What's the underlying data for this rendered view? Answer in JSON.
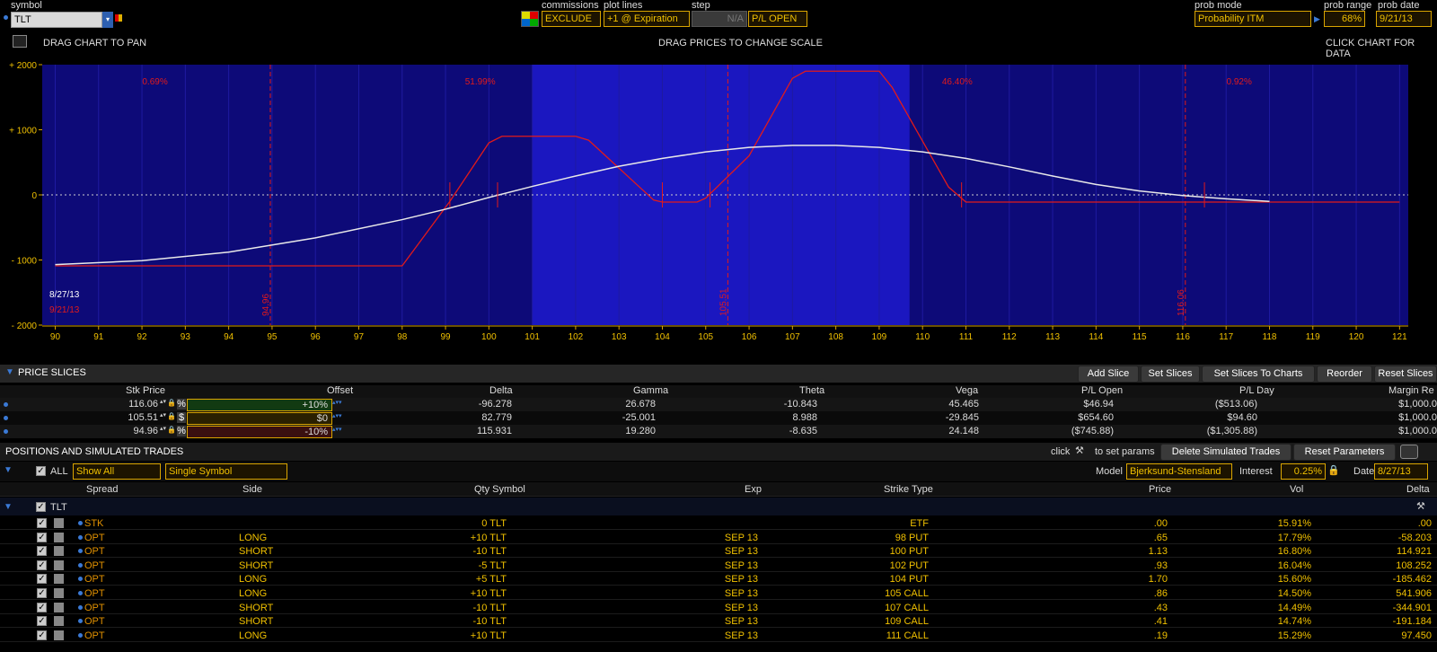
{
  "toolbar": {
    "symbol_label": "symbol",
    "symbol_value": "TLT",
    "commissions_label": "commissions",
    "commissions_value": "EXCLUDE",
    "plot_lines_label": "plot lines",
    "plot_lines_value": "+1 @ Expiration",
    "step_label": "step",
    "step_value": "N/A",
    "pl_mode_value": "P/L OPEN",
    "prob_mode_label": "prob mode",
    "prob_mode_value": "Probability ITM",
    "prob_range_label": "prob range",
    "prob_range_value": "68%",
    "prob_date_label": "prob date",
    "prob_date_value": "9/21/13"
  },
  "hints": {
    "pan": "DRAG CHART TO PAN",
    "scale": "DRAG PRICES TO CHANGE SCALE",
    "details": "CLICK CHART FOR DATA"
  },
  "chart_data": {
    "type": "line",
    "ylim": [
      -2000,
      2000
    ],
    "xlim": [
      89.7,
      121.2
    ],
    "y_ticks": [
      "+ 2000",
      "+ 1000",
      "0",
      "- 1000",
      "- 2000"
    ],
    "y_tick_values": [
      2000,
      1000,
      0,
      -1000,
      -2000
    ],
    "x_ticks": [
      90,
      91,
      92,
      93,
      94,
      95,
      96,
      97,
      98,
      99,
      100,
      101,
      102,
      103,
      104,
      105,
      106,
      107,
      108,
      109,
      110,
      111,
      112,
      113,
      114,
      115,
      116,
      117,
      118,
      119,
      120,
      121
    ],
    "prob_labels": [
      "0.69%",
      "51.99%",
      "46.40%",
      "0.92%"
    ],
    "prob_label_x": [
      92.3,
      99.8,
      110.8,
      117.3
    ],
    "slice_lines": [
      {
        "label": "94.96",
        "x": 94.96
      },
      {
        "label": "105.51",
        "x": 105.51
      },
      {
        "label": "116.06",
        "x": 116.06
      }
    ],
    "highlight_band": [
      101,
      109.7
    ],
    "dates": [
      "8/27/13",
      "9/21/13"
    ],
    "series": [
      {
        "name": "9/21/13",
        "color": "#e21a1a",
        "x": [
          90,
          98,
          99.1,
          100,
          100.3,
          102,
          102.3,
          103.8,
          104,
          104.8,
          105,
          106,
          107,
          107.3,
          109,
          109.3,
          110.6,
          111,
          121
        ],
        "values": [
          -1090,
          -1090,
          -100,
          800,
          900,
          900,
          840,
          -80,
          -110,
          -110,
          -50,
          600,
          1790,
          1900,
          1900,
          1650,
          120,
          -110,
          -110
        ]
      },
      {
        "name": "8/27/13",
        "color": "#e8e8e8",
        "x": [
          90,
          92,
          94,
          96,
          98,
          99,
          100,
          101,
          102,
          103,
          104,
          105,
          106,
          107,
          108,
          109,
          110,
          111,
          112,
          113,
          114,
          115,
          116,
          117,
          118
        ],
        "values": [
          -1070,
          -1010,
          -880,
          -660,
          -380,
          -220,
          -40,
          130,
          290,
          440,
          560,
          660,
          730,
          760,
          760,
          730,
          660,
          560,
          430,
          290,
          160,
          60,
          -10,
          -60,
          -100
        ]
      }
    ]
  },
  "price_slices": {
    "title": "PRICE SLICES",
    "buttons": [
      "Add Slice",
      "Set Slices",
      "Set Slices To Charts",
      "Reorder",
      "Reset Slices"
    ],
    "headers": [
      "Stk Price",
      "Offset",
      "Delta",
      "Gamma",
      "Theta",
      "Vega",
      "P/L Open",
      "P/L Day",
      "Margin Re"
    ],
    "rows": [
      {
        "stk": "116.06",
        "unit": "%",
        "offset": "+10%",
        "offset_color": "#123a12",
        "delta": "-96.278",
        "gamma": "26.678",
        "theta": "-10.843",
        "vega": "45.465",
        "pl_open": "$46.94",
        "pl_day": "($513.06)",
        "margin": "$1,000.0"
      },
      {
        "stk": "105.51",
        "unit": "$",
        "offset": "$0",
        "offset_color": "#2a2000",
        "delta": "82.779",
        "gamma": "-25.001",
        "theta": "8.988",
        "vega": "-29.845",
        "pl_open": "$654.60",
        "pl_day": "$94.60",
        "margin": "$1,000.0"
      },
      {
        "stk": "94.96",
        "unit": "%",
        "offset": "-10%",
        "offset_color": "#3a1010",
        "delta": "115.931",
        "gamma": "19.280",
        "theta": "-8.635",
        "vega": "24.148",
        "pl_open": "($745.88)",
        "pl_day": "($1,305.88)",
        "margin": "$1,000.0"
      }
    ]
  },
  "positions": {
    "title": "POSITIONS AND SIMULATED TRADES",
    "click_hint": "click",
    "click_hint2": "to set params",
    "delete_btn": "Delete Simulated Trades",
    "reset_btn": "Reset Parameters",
    "all_label": "ALL",
    "filter_value": "Show All",
    "symbol_mode": "Single Symbol",
    "model_label": "Model",
    "model_value": "Bjerksund-Stensland",
    "interest_label": "Interest",
    "interest_value": "0.25%",
    "date_label": "Date",
    "date_value": "8/27/13",
    "headers": [
      "Spread",
      "Side",
      "Qty Symbol",
      "Exp",
      "Strike Type",
      "Price",
      "Vol",
      "Delta"
    ],
    "group": "TLT",
    "rows": [
      {
        "spread": "STK",
        "side": "",
        "qty": "0 TLT",
        "exp": "",
        "strike": "ETF",
        "price": ".00",
        "vol": "15.91%",
        "delta": ".00"
      },
      {
        "spread": "OPT",
        "side": "LONG",
        "qty": "+10 TLT",
        "exp": "SEP 13",
        "strike": "98 PUT",
        "price": ".65",
        "vol": "17.79%",
        "delta": "-58.203"
      },
      {
        "spread": "OPT",
        "side": "SHORT",
        "qty": "-10 TLT",
        "exp": "SEP 13",
        "strike": "100 PUT",
        "price": "1.13",
        "vol": "16.80%",
        "delta": "114.921"
      },
      {
        "spread": "OPT",
        "side": "SHORT",
        "qty": "-5 TLT",
        "exp": "SEP 13",
        "strike": "102 PUT",
        "price": ".93",
        "vol": "16.04%",
        "delta": "108.252"
      },
      {
        "spread": "OPT",
        "side": "LONG",
        "qty": "+5 TLT",
        "exp": "SEP 13",
        "strike": "104 PUT",
        "price": "1.70",
        "vol": "15.60%",
        "delta": "-185.462"
      },
      {
        "spread": "OPT",
        "side": "LONG",
        "qty": "+10 TLT",
        "exp": "SEP 13",
        "strike": "105 CALL",
        "price": ".86",
        "vol": "14.50%",
        "delta": "541.906"
      },
      {
        "spread": "OPT",
        "side": "SHORT",
        "qty": "-10 TLT",
        "exp": "SEP 13",
        "strike": "107 CALL",
        "price": ".43",
        "vol": "14.49%",
        "delta": "-344.901"
      },
      {
        "spread": "OPT",
        "side": "SHORT",
        "qty": "-10 TLT",
        "exp": "SEP 13",
        "strike": "109 CALL",
        "price": ".41",
        "vol": "14.74%",
        "delta": "-191.184"
      },
      {
        "spread": "OPT",
        "side": "LONG",
        "qty": "+10 TLT",
        "exp": "SEP 13",
        "strike": "111 CALL",
        "price": ".19",
        "vol": "15.29%",
        "delta": "97.450"
      }
    ]
  }
}
